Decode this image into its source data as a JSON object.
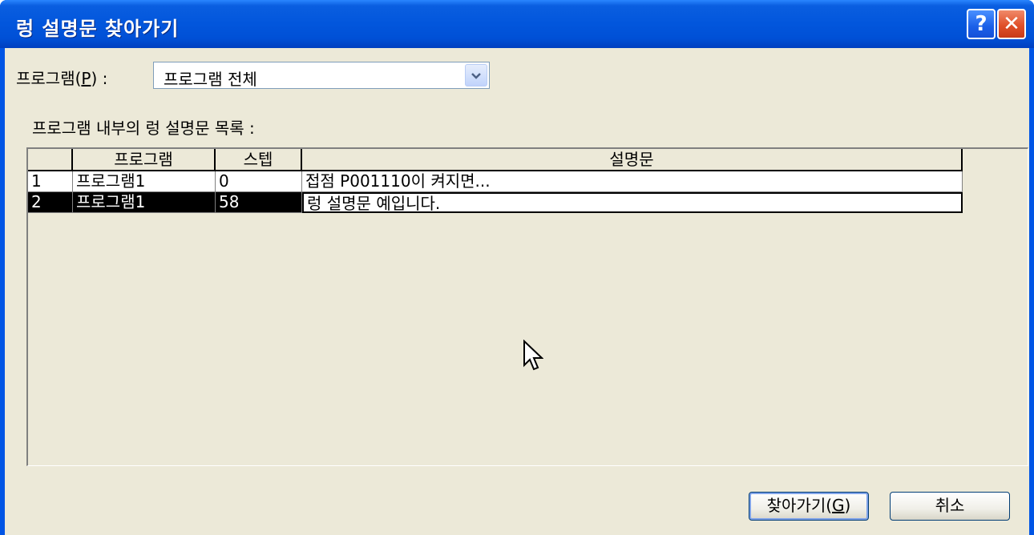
{
  "window": {
    "title": "렁 설명문 찾아가기",
    "help_label": "?",
    "close_label": "✕"
  },
  "program_filter": {
    "label": "프로그램(P) :",
    "label_prefix": "프로그램(",
    "label_mnemonic": "P",
    "label_suffix": ") :",
    "selected": "프로그램 전체"
  },
  "list": {
    "caption": "프로그램 내부의 렁 설명문 목록 :",
    "columns": [
      "",
      "프로그램",
      "스텝",
      "설명문"
    ],
    "rows": [
      {
        "index": "1",
        "program": "프로그램1",
        "step": "0",
        "description": "접점 P001110이 켜지면..."
      },
      {
        "index": "2",
        "program": "프로그램1",
        "step": "58",
        "description": "렁 설명문 예입니다."
      }
    ],
    "selected_row": 2
  },
  "buttons": {
    "goto_prefix": "찾아가기(",
    "goto_mnemonic": "G",
    "goto_suffix": ")",
    "cancel": "취소"
  },
  "colors": {
    "title_bar": "#0055e5",
    "dialog_bg": "#ece9d8",
    "selection": "#000000"
  },
  "icons": {
    "help": "question-icon",
    "close": "close-icon",
    "dropdown": "chevron-down-icon",
    "cursor": "mouse-pointer-icon"
  }
}
